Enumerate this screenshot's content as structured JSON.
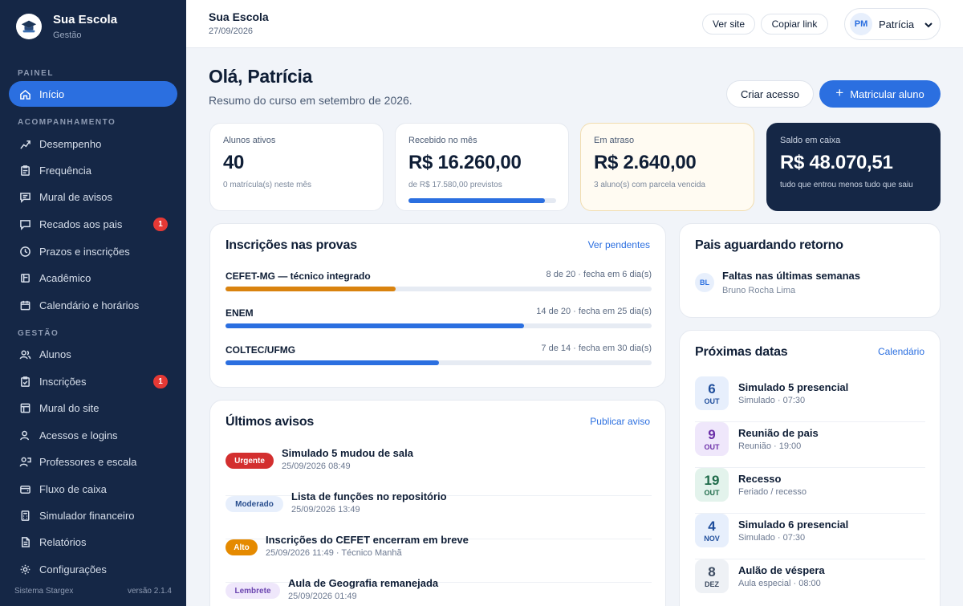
{
  "sidebar": {
    "brand_name": "Sua Escola",
    "brand_sub": "Gestão",
    "sections": [
      "PAINEL",
      "ACOMPANHAMENTO",
      "GESTÃO"
    ],
    "items": [
      {
        "label": "Início",
        "icon": "home-icon",
        "active": true
      },
      {
        "label": "Desempenho",
        "icon": "chart-icon"
      },
      {
        "label": "Frequência",
        "icon": "clipboard-icon"
      },
      {
        "label": "Mural de avisos",
        "icon": "message-icon"
      },
      {
        "label": "Recados aos pais",
        "icon": "chat-icon",
        "badge": "1"
      },
      {
        "label": "Prazos e inscrições",
        "icon": "clock-icon"
      },
      {
        "label": "Acadêmico",
        "icon": "book-icon"
      },
      {
        "label": "Calendário e horários",
        "icon": "calendar-icon"
      },
      {
        "label": "Alunos",
        "icon": "users-icon"
      },
      {
        "label": "Inscrições",
        "icon": "clipboard-check-icon",
        "badge": "1"
      },
      {
        "label": "Mural do site",
        "icon": "layout-icon"
      },
      {
        "label": "Acessos e logins",
        "icon": "key-user-icon"
      },
      {
        "label": "Professores e escala",
        "icon": "teacher-icon"
      },
      {
        "label": "Fluxo de caixa",
        "icon": "wallet-icon"
      },
      {
        "label": "Simulador financeiro",
        "icon": "calculator-icon"
      },
      {
        "label": "Relatórios",
        "icon": "file-icon"
      },
      {
        "label": "Configurações",
        "icon": "gear-icon"
      }
    ],
    "footer_left": "Sistema Stargex",
    "footer_right": "versão 2.1.4"
  },
  "topbar": {
    "title": "Sua Escola",
    "date": "27/09/2026",
    "view_site": "Ver site",
    "copy_link": "Copiar link",
    "user_initials": "PM",
    "user_name": "Patrícia"
  },
  "header": {
    "greeting": "Olá, Patrícia",
    "subtitle": "Resumo do curso em setembro de 2026.",
    "create_access": "Criar acesso",
    "enroll_student": "Matricular aluno"
  },
  "stats": {
    "active": {
      "label": "Alunos ativos",
      "value": "40",
      "note": "0 matrícula(s) neste mês"
    },
    "received": {
      "label": "Recebido no mês",
      "value": "R$ 16.260,00",
      "note": "de R$ 17.580,00 previstos",
      "progress": 0.925
    },
    "overdue": {
      "label": "Em atraso",
      "value": "R$ 2.640,00",
      "note": "3 aluno(s) com parcela vencida"
    },
    "balance": {
      "label": "Saldo em caixa",
      "value": "R$ 48.070,51",
      "note": "tudo que entrou menos tudo que saiu"
    }
  },
  "exams": {
    "title": "Inscrições nas provas",
    "link": "Ver pendentes",
    "items": [
      {
        "name": "CEFET-MG — técnico integrado",
        "meta": "8 de 20 · fecha em 6 dia(s)",
        "progress": 0.4,
        "color": "#d9830f"
      },
      {
        "name": "ENEM",
        "meta": "14 de 20 · fecha em 25 dia(s)",
        "progress": 0.7,
        "color": "#2b6fe0"
      },
      {
        "name": "COLTEC/UFMG",
        "meta": "7 de 14 · fecha em 30 dia(s)",
        "progress": 0.5,
        "color": "#2b6fe0"
      }
    ]
  },
  "notices": {
    "title": "Últimos avisos",
    "link": "Publicar aviso",
    "items": [
      {
        "tag": "Urgente",
        "tag_bg": "#d32f2f",
        "tag_fg": "#ffffff",
        "title": "Simulado 5 mudou de sala",
        "time": "25/09/2026 08:49"
      },
      {
        "tag": "Moderado",
        "tag_bg": "#e7effc",
        "tag_fg": "#2a4f8f",
        "title": "Lista de funções no repositório",
        "time": "25/09/2026 13:49"
      },
      {
        "tag": "Alto",
        "tag_bg": "#e58a00",
        "tag_fg": "#ffffff",
        "title": "Inscrições do CEFET encerram em breve",
        "time": "25/09/2026 11:49 · Técnico Manhã"
      },
      {
        "tag": "Lembrete",
        "tag_bg": "#efe7fb",
        "tag_fg": "#6b46b0",
        "title": "Aula de Geografia remanejada",
        "time": "25/09/2026 01:49"
      }
    ]
  },
  "pending": {
    "title": "Pais aguardando retorno",
    "initials": "BL",
    "item_title": "Faltas nas últimas semanas",
    "item_name": "Bruno Rocha Lima"
  },
  "dates": {
    "title": "Próximas datas",
    "link": "Calendário",
    "items": [
      {
        "day": "6",
        "month": "OUT",
        "title": "Simulado 5 presencial",
        "sub": "Simulado · 07:30",
        "bg": "#e7effc",
        "fg": "#1f4e9c"
      },
      {
        "day": "9",
        "month": "OUT",
        "title": "Reunião de pais",
        "sub": "Reunião · 19:00",
        "bg": "#efe7fb",
        "fg": "#6b2fa8"
      },
      {
        "day": "19",
        "month": "OUT",
        "title": "Recesso",
        "sub": "Feriado / recesso",
        "bg": "#e3f3ec",
        "fg": "#1f6b4a"
      },
      {
        "day": "4",
        "month": "NOV",
        "title": "Simulado 6 presencial",
        "sub": "Simulado · 07:30",
        "bg": "#e7effc",
        "fg": "#1f4e9c"
      },
      {
        "day": "8",
        "month": "DEZ",
        "title": "Aulão de véspera",
        "sub": "Aula especial · 08:00",
        "bg": "#eef1f5",
        "fg": "#3b4a60"
      }
    ]
  },
  "colors": {
    "accent": "#2b6fe0",
    "sidebar": "#152746",
    "danger": "#e53935"
  }
}
